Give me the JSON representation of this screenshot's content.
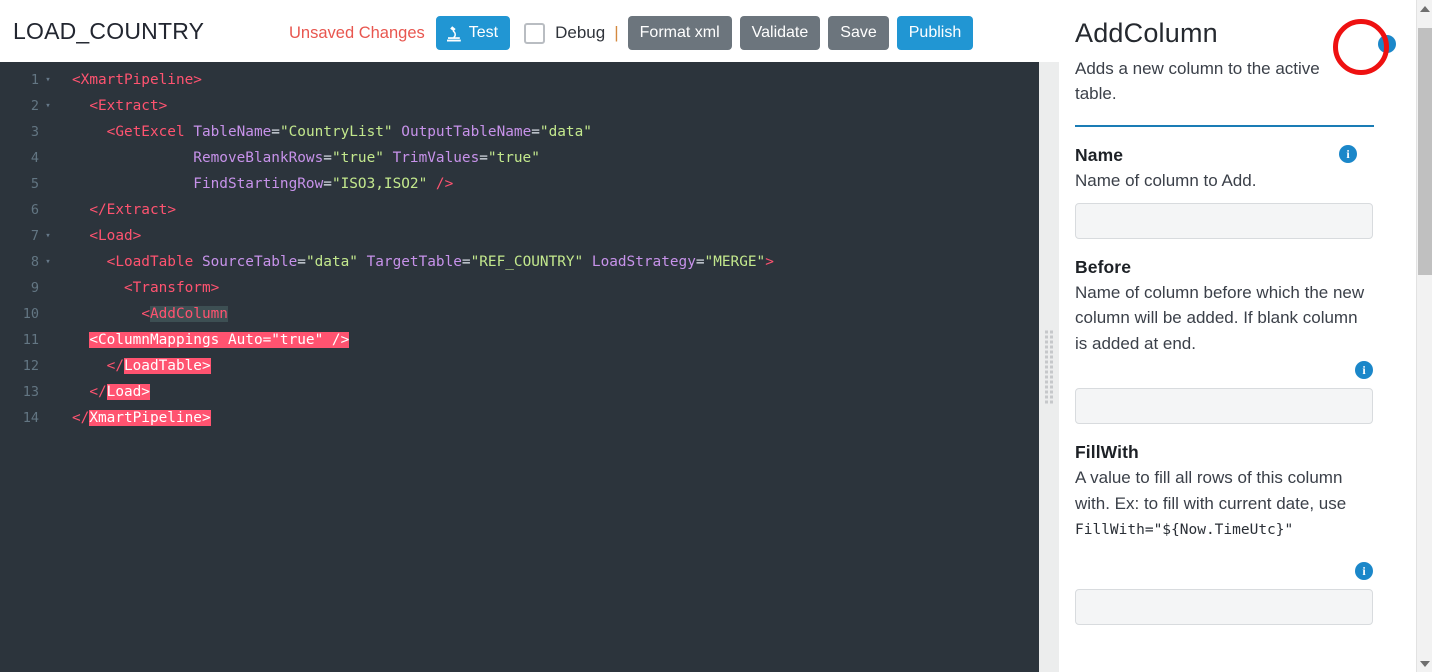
{
  "header": {
    "pipeline_title": "LOAD_COUNTRY",
    "unsaved_label": "Unsaved Changes",
    "test_label": "Test",
    "test_icon": "microscope-icon",
    "debug_label": "Debug",
    "separator": "|",
    "format_xml_label": "Format xml",
    "validate_label": "Validate",
    "save_label": "Save",
    "publish_label": "Publish",
    "debug_checked": false,
    "colors": {
      "accent_blue": "#2196d3",
      "grey_button": "#6c757d",
      "unsaved_red": "#e8564f"
    }
  },
  "editor": {
    "theme_background": "#2c343c",
    "colors": {
      "tag": "#ff5370",
      "attribute": "#c792ea",
      "value": "#c3e88d",
      "gutter": "#637683",
      "error_highlight": "#ff5370",
      "selection": "#3d4f53"
    },
    "lines": [
      {
        "num": "1",
        "fold": "▾",
        "text": "<XmartPipeline>"
      },
      {
        "num": "2",
        "fold": "▾",
        "text": "  <Extract>"
      },
      {
        "num": "3",
        "fold": "",
        "text": "    <GetExcel TableName=\"CountryList\" OutputTableName=\"data\""
      },
      {
        "num": "4",
        "fold": "",
        "text": "              RemoveBlankRows=\"true\" TrimValues=\"true\""
      },
      {
        "num": "5",
        "fold": "",
        "text": "              FindStartingRow=\"ISO3,ISO2\" />"
      },
      {
        "num": "6",
        "fold": "",
        "text": "  </Extract>"
      },
      {
        "num": "7",
        "fold": "▾",
        "text": "  <Load>"
      },
      {
        "num": "8",
        "fold": "▾",
        "text": "    <LoadTable SourceTable=\"data\" TargetTable=\"REF_COUNTRY\" LoadStrategy=\"MERGE\">"
      },
      {
        "num": "9",
        "fold": "",
        "text": "      <Transform>"
      },
      {
        "num": "10",
        "fold": "",
        "text": "        <AddColumn"
      },
      {
        "num": "11",
        "fold": "",
        "text": "  <ColumnMappings Auto=\"true\" />"
      },
      {
        "num": "12",
        "fold": "",
        "text": "    </LoadTable>"
      },
      {
        "num": "13",
        "fold": "",
        "text": "  </Load>"
      },
      {
        "num": "14",
        "fold": "",
        "text": "</XmartPipeline>"
      }
    ]
  },
  "splitter": {
    "name": "panel-resize-handle"
  },
  "panel": {
    "title": "AddColumn",
    "description": "Adds a new column to the active table.",
    "info_icon": "info-icon",
    "annotation": {
      "shape": "circle",
      "color": "#ee1111",
      "target": "panel-info-icon"
    },
    "divider_color": "#1a7cb5",
    "fields": [
      {
        "label": "Name",
        "help": "Name of column to Add.",
        "help_code": "",
        "value": "",
        "placeholder": "",
        "info_position": "label-row"
      },
      {
        "label": "Before",
        "help": "Name of column before which the new column will be added. If blank column is added at end.",
        "help_code": "",
        "value": "",
        "placeholder": "",
        "info_position": "below-help"
      },
      {
        "label": "FillWith",
        "help": "A value to fill all rows of this column with. Ex: to fill with current date, use",
        "help_code": "FillWith=\"${Now.TimeUtc}\"",
        "value": "",
        "placeholder": "",
        "info_position": "below-help"
      }
    ]
  },
  "scrollbar": {
    "up_arrow": "scroll-up-arrow",
    "down_arrow": "scroll-down-arrow",
    "thumb": "scroll-thumb"
  }
}
